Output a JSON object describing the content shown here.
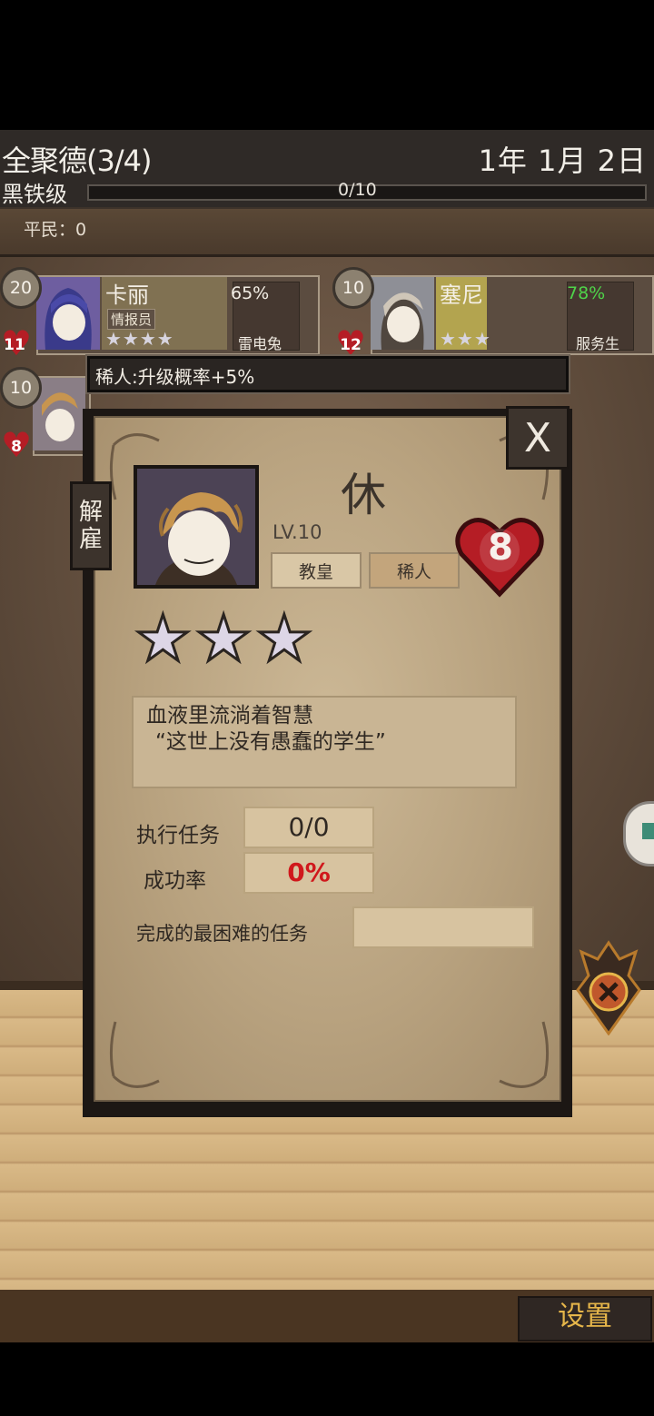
{
  "header": {
    "guild_name": "全聚德(3/4)",
    "date": "1年 1月 2日",
    "rank": "黑铁级",
    "xp_text": "0/10",
    "xp_progress": 0
  },
  "commoners_label": "平民：0",
  "roster": [
    {
      "level": "20",
      "hearts": "11",
      "name": "卡丽",
      "role": "情报员",
      "stars": "★★★★",
      "rate": "65%",
      "rate_color": "#f0ebe2",
      "task": "雷电兔"
    },
    {
      "level": "10",
      "hearts": "12",
      "name": "塞尼",
      "role": "",
      "stars": "★★★",
      "rate": "78%",
      "rate_color": "#4fd44a",
      "task": "服务生"
    },
    {
      "level": "10",
      "hearts": "8"
    }
  ],
  "tooltip": "稀人:升级概率+5%",
  "detail": {
    "name": "休",
    "level": "LV.10",
    "tag_class": "教皇",
    "tag_rarity": "稀人",
    "hearts": "8",
    "stars": "★★★",
    "star_count": 3,
    "quote_line1": "血液里流淌着智慧",
    "quote_line2": "“这世上没有愚蠢的学生”",
    "missions_label": "执行任务",
    "missions_value": "0/0",
    "success_label": "成功率",
    "success_value": "0%",
    "hardest_label": "完成的最困难的任务",
    "hardest_value": ""
  },
  "buttons": {
    "close": "X",
    "dismiss": "解雇",
    "settings": "设置"
  },
  "colors": {
    "success_red": "#d0181c",
    "settings_gold": "#e6b64a",
    "heart_red": "#b51d25"
  }
}
